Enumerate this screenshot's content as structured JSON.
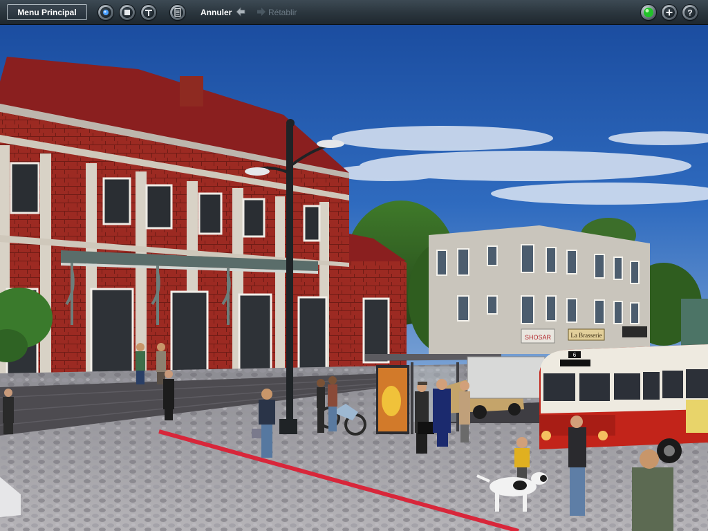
{
  "toolbar": {
    "menu_label": "Menu Principal",
    "undo_label": "Annuler",
    "redo_label": "Rétablir",
    "left_icons": [
      "record-icon",
      "stop-icon",
      "tool-icon",
      "calculator-icon"
    ],
    "right_icons": [
      "status-light-icon",
      "add-icon",
      "help-icon"
    ]
  },
  "scene": {
    "shop_signs": [
      "SHOSAR",
      "La Brasserie"
    ],
    "bus_destination": "6"
  },
  "colors": {
    "toolbar_bg": "#2a353d",
    "sky": "#2a62b6",
    "bus_red": "#c2241a",
    "bus_cream": "#eeeae0",
    "brick": "#9c2a22",
    "roof": "#8a1f1f",
    "platform_line": "#d8263a",
    "status_green": "#21c229"
  }
}
